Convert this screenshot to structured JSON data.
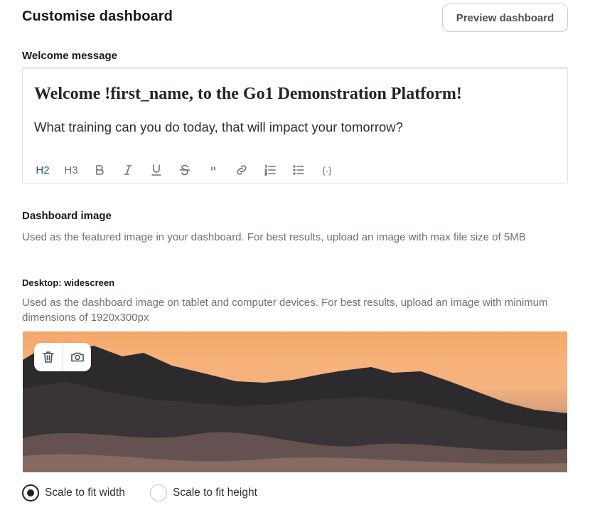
{
  "header": {
    "title": "Customise dashboard",
    "preview_button": "Preview dashboard"
  },
  "welcome": {
    "label": "Welcome message",
    "heading": "Welcome !first_name, to the Go1 Demonstration Platform!",
    "body": "What training can you do today, that will impact your tomorrow?",
    "toolbar": [
      {
        "label": "H2",
        "icon": "heading-2",
        "active": true
      },
      {
        "label": "H3",
        "icon": "heading-3",
        "active": false
      },
      {
        "label": "B",
        "icon": "bold-icon"
      },
      {
        "label": "I",
        "icon": "italic-icon"
      },
      {
        "label": "U",
        "icon": "underline-icon"
      },
      {
        "label": "S",
        "icon": "strikethrough-icon"
      },
      {
        "label": "\"",
        "icon": "quote-icon"
      },
      {
        "label": "",
        "icon": "link-icon"
      },
      {
        "label": "",
        "icon": "ordered-list-icon"
      },
      {
        "label": "",
        "icon": "bullet-list-icon"
      },
      {
        "label": "{-}",
        "icon": "variable-icon"
      }
    ]
  },
  "dashboard_image": {
    "label": "Dashboard image",
    "help": "Used as the featured image in your dashboard. For best results, upload an image with max file size of 5MB",
    "desktop": {
      "label": "Desktop: widescreen",
      "help": "Used as the dashboard image on tablet and computer devices. For best results, upload an image with minimum dimensions of 1920x300px",
      "image_alt": "Misty forested hills at sunset",
      "actions": [
        {
          "icon": "trash-icon"
        },
        {
          "icon": "camera-icon"
        }
      ]
    },
    "scale_options": [
      {
        "label": "Scale to fit width",
        "checked": true
      },
      {
        "label": "Scale to fit height",
        "checked": false
      }
    ]
  }
}
